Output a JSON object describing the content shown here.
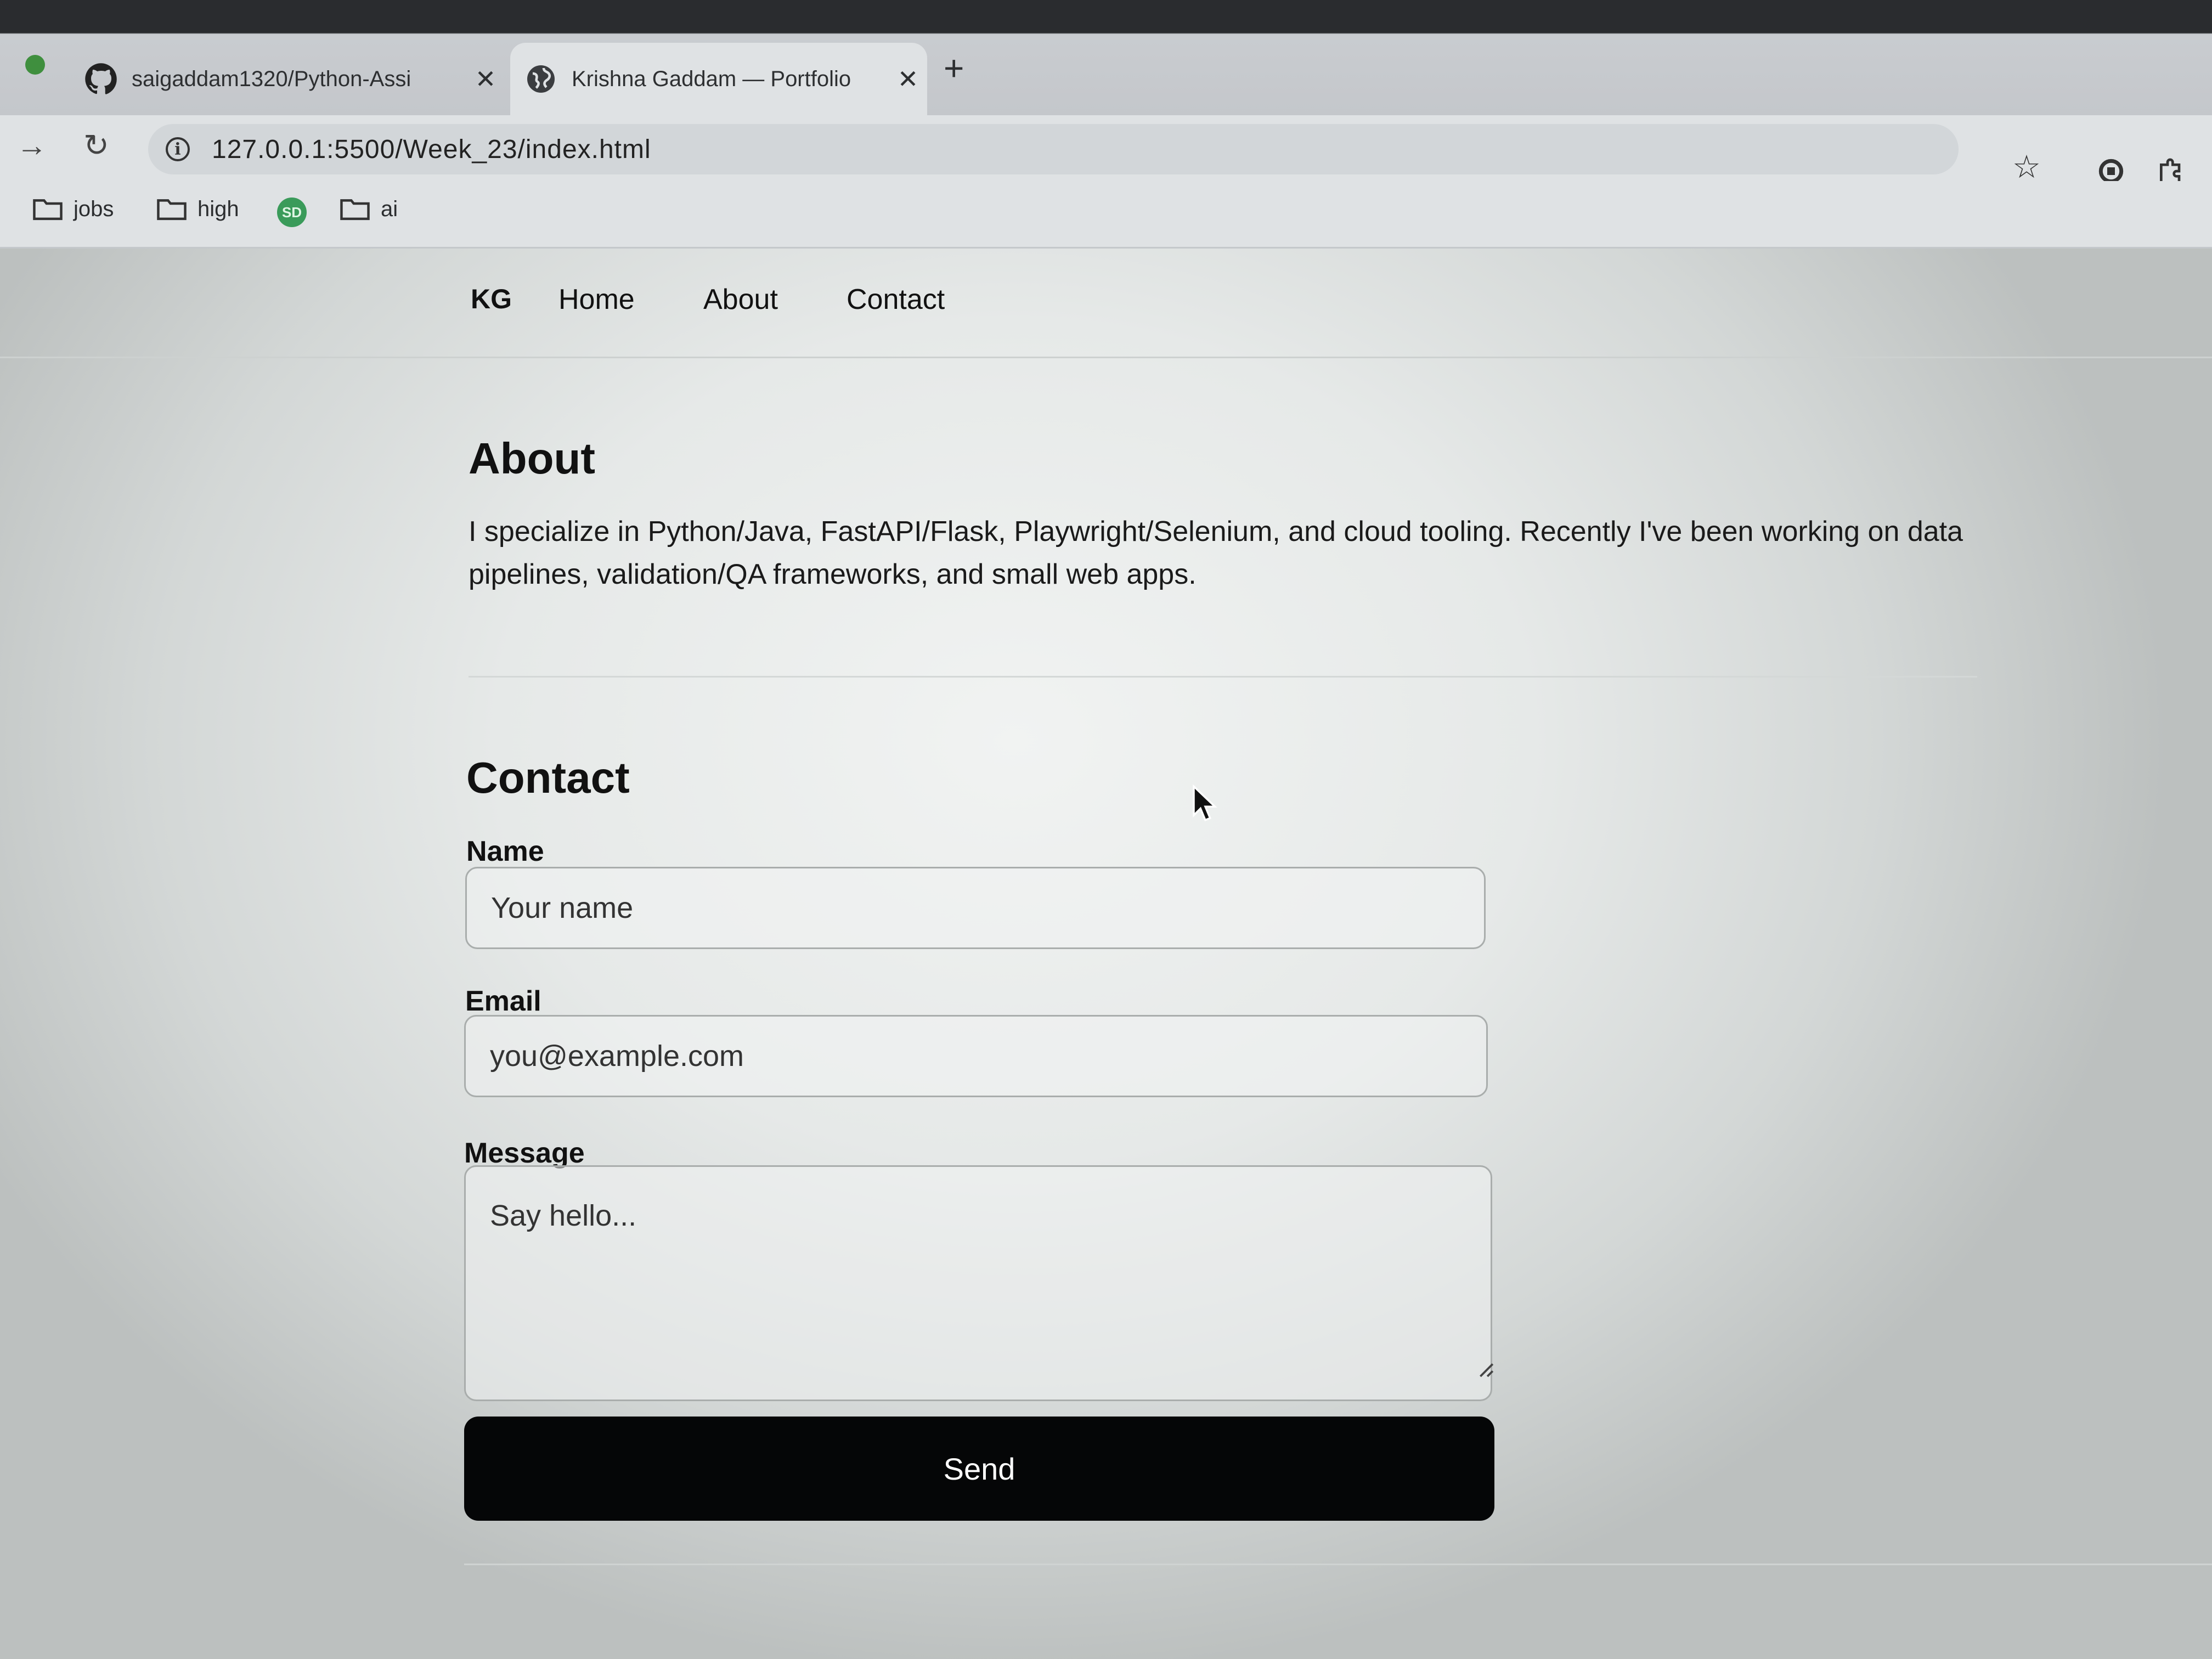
{
  "browser": {
    "tabs": [
      {
        "title": "saigaddam1320/Python-Assi",
        "icon": "github-icon",
        "close": "✕"
      },
      {
        "title": "Krishna Gaddam — Portfolio",
        "icon": "globe-icon",
        "close": "✕"
      }
    ],
    "new_tab": "+",
    "url": "127.0.0.1:5500/Week_23/index.html",
    "bookmarks": [
      {
        "label": "jobs",
        "icon": "folder-icon"
      },
      {
        "label": "high",
        "icon": "folder-icon"
      },
      {
        "label": "",
        "icon": "site-favicon-icon",
        "badge": "SD"
      },
      {
        "label": "ai",
        "icon": "folder-icon"
      }
    ]
  },
  "nav": {
    "brand": "KG",
    "links": [
      "Home",
      "About",
      "Contact"
    ]
  },
  "about": {
    "heading": "About",
    "text": "I specialize in Python/Java, FastAPI/Flask, Playwright/Selenium, and cloud tooling. Recently I've been working on data pipelines, validation/QA frameworks, and small web apps."
  },
  "contact": {
    "heading": "Contact",
    "name_label": "Name",
    "name_placeholder": "Your name",
    "email_label": "Email",
    "email_placeholder": "you@example.com",
    "message_label": "Message",
    "message_placeholder": "Say hello...",
    "send_label": "Send"
  },
  "colors": {
    "send_button_bg": "#050607",
    "text": "#111111",
    "status_dot": "#3f8f3e"
  }
}
